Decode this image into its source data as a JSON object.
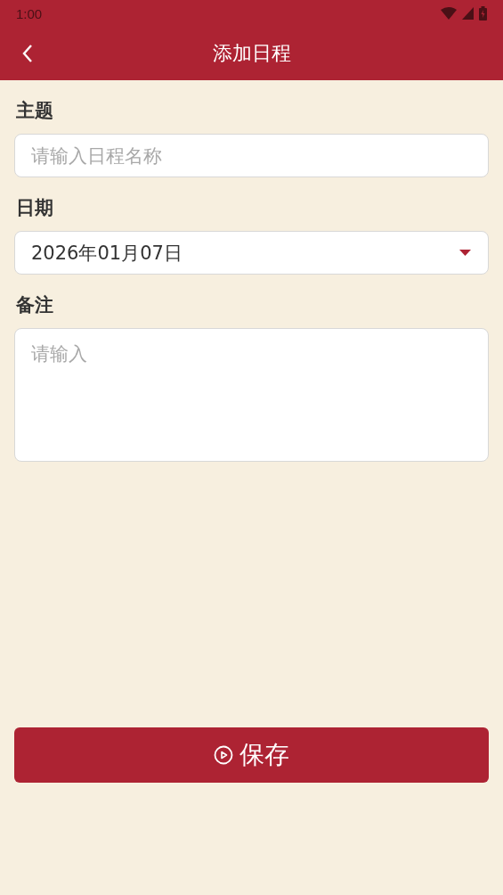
{
  "status_bar": {
    "time": "1:00"
  },
  "header": {
    "title": "添加日程"
  },
  "form": {
    "subject": {
      "label": "主题",
      "placeholder": "请输入日程名称"
    },
    "date": {
      "label": "日期",
      "value": "2026年01月07日"
    },
    "note": {
      "label": "备注",
      "placeholder": "请输入"
    }
  },
  "save_button": {
    "label": "保存"
  }
}
